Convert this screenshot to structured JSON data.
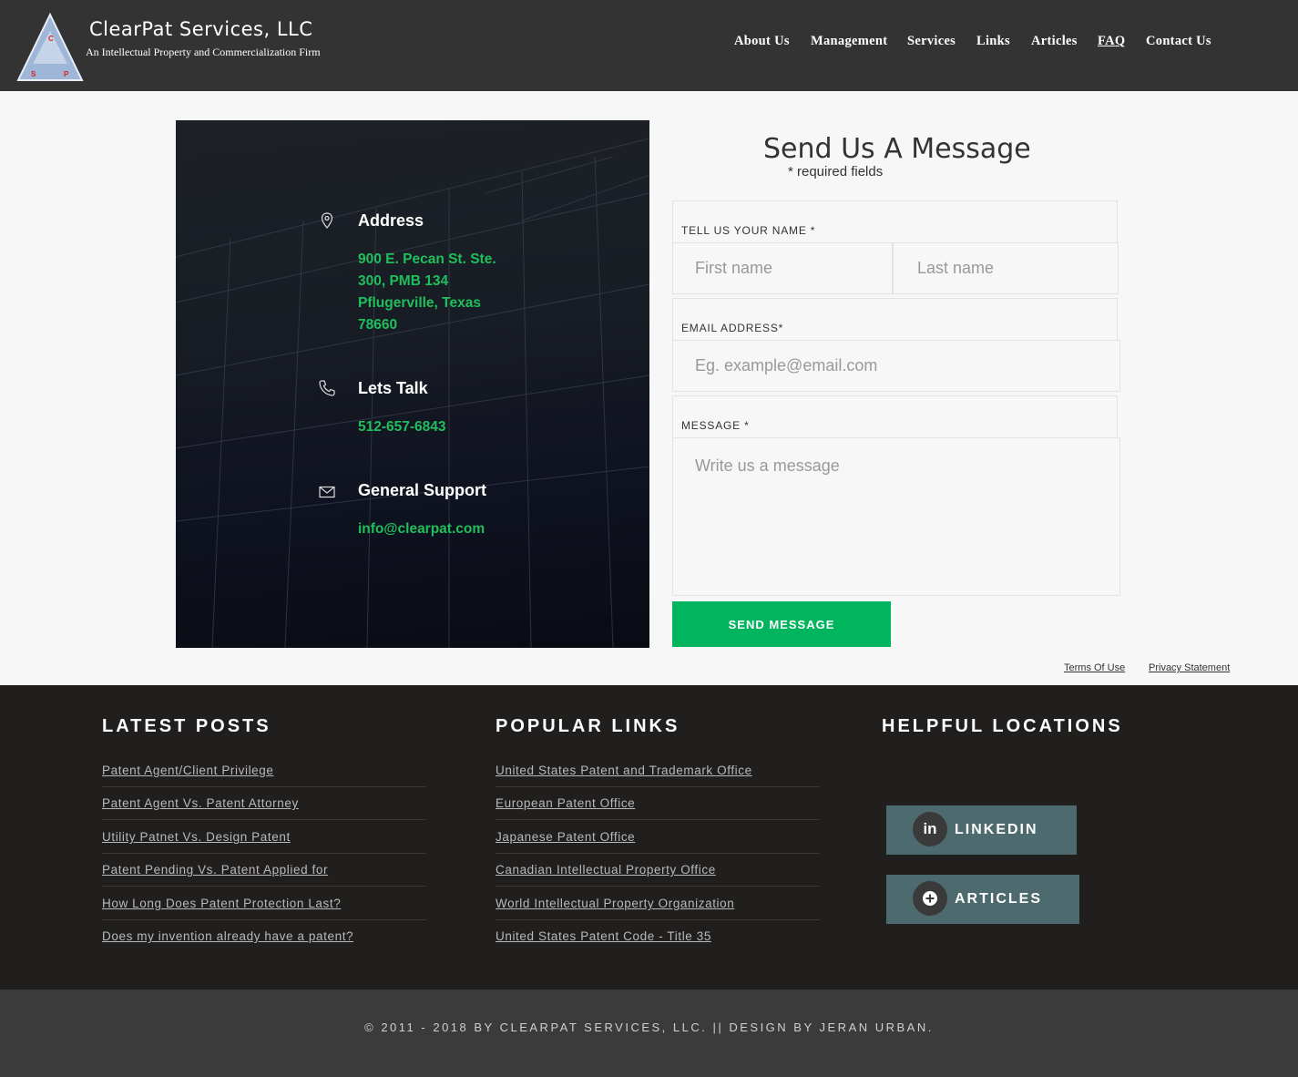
{
  "header": {
    "brand_name": "ClearPat Services, LLC",
    "tagline": "An Intellectual Property and Commercialization Firm",
    "logo_letters": [
      "C",
      "S",
      "P"
    ],
    "nav": [
      "About Us",
      "Management",
      "Services",
      "Links",
      "Articles",
      "FAQ",
      "Contact Us"
    ]
  },
  "contact_card": {
    "address_label": "Address",
    "address_lines": [
      "900 E. Pecan St. Ste.",
      "300, PMB 134",
      "Pflugerville, Texas",
      "78660"
    ],
    "phone_label": "Lets Talk",
    "phone": "512-657-6843",
    "support_label": "General Support",
    "email": "info@clearpat.com"
  },
  "form": {
    "title": "Send Us A Message",
    "required_note": "* required fields",
    "name_label": "TELL US YOUR NAME *",
    "first_name_placeholder": "First name",
    "last_name_placeholder": "Last name",
    "email_label": "EMAIL ADDRESS*",
    "email_placeholder": "Eg. example@email.com",
    "message_label": "MESSAGE *",
    "message_placeholder": "Write us a message",
    "send_label": "SEND MESSAGE"
  },
  "legal": {
    "terms": "Terms Of Use",
    "privacy": "Privacy Statement"
  },
  "footer": {
    "latest_posts": {
      "heading": "LATEST POSTS",
      "items": [
        "Patent Agent/Client Privilege",
        "Patent Agent Vs. Patent Attorney",
        "Utility Patnet Vs. Design Patent",
        "Patent Pending Vs. Patent Applied for",
        "How Long Does Patent Protection Last?",
        "Does my invention already have a patent?"
      ]
    },
    "popular_links": {
      "heading": "POPULAR LINKS",
      "items": [
        "United States Patent and Trademark Office",
        "European Patent Office",
        "Japanese Patent Office",
        "Canadian Intellectual Property Office",
        "World Intellectual Property Organization",
        "United States Patent Code - Title 35"
      ]
    },
    "helpful_locations": {
      "heading": "HELPFUL LOCATIONS",
      "linkedin_label": "LINKEDIN",
      "linkedin_icon_text": "in",
      "articles_label": "ARTICLES"
    },
    "copyright": "© 2011 - 2018 BY CLEARPAT SERVICES, LLC. || DESIGN BY JERAN URBAN."
  },
  "colors": {
    "header_bg": "#333333",
    "accent_green": "#00b55e",
    "contact_text_green": "#1fbf5c",
    "footer_bg": "#211f1e",
    "social_button": "#4d6b6f"
  },
  "icons": {
    "address": "map-pin-icon",
    "phone": "phone-icon",
    "email": "envelope-icon",
    "linkedin": "linkedin-icon",
    "articles": "plus-circle-icon"
  }
}
